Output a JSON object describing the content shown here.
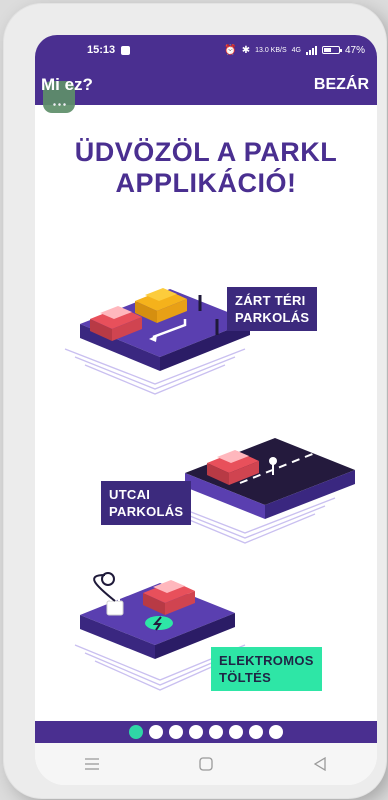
{
  "status": {
    "time": "15:13",
    "net_speed": "13.0 KB/S",
    "net_type": "4G",
    "battery_percent": "47%"
  },
  "appbar": {
    "title": "Mi ez?",
    "close_label": "BEZÁR"
  },
  "heading": {
    "line1": "ÜDVÖZÖL A PARKL",
    "line2": "APPLIKÁCIÓ!"
  },
  "features": [
    {
      "line1": "ZÁRT TÉRI",
      "line2": "PARKOLÁS",
      "label_color": "#3c2a7d"
    },
    {
      "line1": "UTCAI",
      "line2": "PARKOLÁS",
      "label_color": "#3c2a7d"
    },
    {
      "line1": "ELEKTROMOS",
      "line2": "TÖLTÉS",
      "label_color": "#2ee6a6"
    }
  ],
  "pager": {
    "total": 8,
    "active_index": 0
  },
  "navbar": {
    "icons": [
      "menu-icon",
      "home-icon",
      "back-icon"
    ]
  },
  "colors": {
    "brand_purple": "#4a2f90",
    "accent_green": "#2fd6a6",
    "car_red": "#e8505b",
    "car_yellow": "#f5b21b"
  }
}
